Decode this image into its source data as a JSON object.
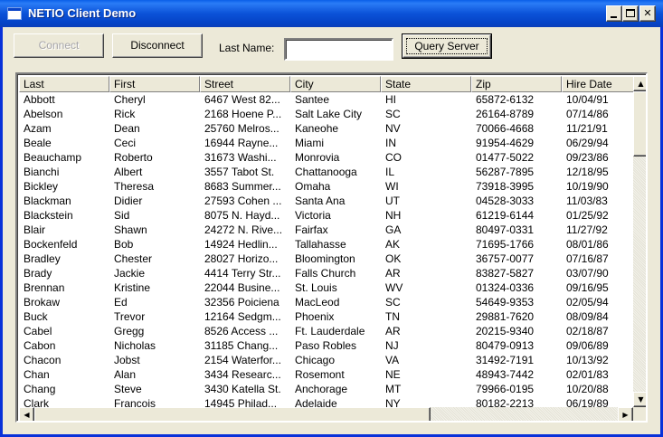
{
  "window": {
    "title": "NETIO Client Demo"
  },
  "icons": {
    "app": "window-icon",
    "minimize": "minimize-icon",
    "maximize": "maximize-icon",
    "close": "close-icon",
    "scroll_up": "up-arrow-icon",
    "scroll_down": "down-arrow-icon",
    "scroll_left": "left-arrow-icon",
    "scroll_right": "right-arrow-icon"
  },
  "toolbar": {
    "connect_label": "Connect",
    "disconnect_label": "Disconnect",
    "lastname_label": "Last Name:",
    "lastname_value": "",
    "query_label": "Query Server"
  },
  "table": {
    "columns": [
      "Last",
      "First",
      "Street",
      "City",
      "State",
      "Zip",
      "Hire Date"
    ],
    "rows": [
      [
        "Abbott",
        "Cheryl",
        "6467 West 82...",
        "Santee",
        "HI",
        "65872-6132",
        "10/04/91"
      ],
      [
        "Abelson",
        "Rick",
        "2168 Hoene P...",
        "Salt Lake City",
        "SC",
        "26164-8789",
        "07/14/86"
      ],
      [
        "Azam",
        "Dean",
        "25760 Melros...",
        "Kaneohe",
        "NV",
        "70066-4668",
        "11/21/91"
      ],
      [
        "Beale",
        "Ceci",
        "16944 Rayne...",
        "Miami",
        "IN",
        "91954-4629",
        "06/29/94"
      ],
      [
        "Beauchamp",
        "Roberto",
        "31673 Washi...",
        "Monrovia",
        "CO",
        "01477-5022",
        "09/23/86"
      ],
      [
        "Bianchi",
        "Albert",
        "3557 Tabot St.",
        "Chattanooga",
        "IL",
        "56287-7895",
        "12/18/95"
      ],
      [
        "Bickley",
        "Theresa",
        "8683 Summer...",
        "Omaha",
        "WI",
        "73918-3995",
        "10/19/90"
      ],
      [
        "Blackman",
        "Didier",
        "27593 Cohen ...",
        "Santa Ana",
        "UT",
        "04528-3033",
        "11/03/83"
      ],
      [
        "Blackstein",
        "Sid",
        "8075 N. Hayd...",
        "Victoria",
        "NH",
        "61219-6144",
        "01/25/92"
      ],
      [
        "Blair",
        "Shawn",
        "24272 N. Rive...",
        "Fairfax",
        "GA",
        "80497-0331",
        "11/27/92"
      ],
      [
        "Bockenfeld",
        "Bob",
        "14924 Hedlin...",
        "Tallahasse",
        "AK",
        "71695-1766",
        "08/01/86"
      ],
      [
        "Bradley",
        "Chester",
        "28027 Horizo...",
        "Bloomington",
        "OK",
        "36757-0077",
        "07/16/87"
      ],
      [
        "Brady",
        "Jackie",
        "4414 Terry Str...",
        "Falls Church",
        "AR",
        "83827-5827",
        "03/07/90"
      ],
      [
        "Brennan",
        "Kristine",
        "22044 Busine...",
        "St. Louis",
        "WV",
        "01324-0336",
        "09/16/95"
      ],
      [
        "Brokaw",
        "Ed",
        "32356 Poiciena",
        "MacLeod",
        "SC",
        "54649-9353",
        "02/05/94"
      ],
      [
        "Buck",
        "Trevor",
        "12164 Sedgm...",
        "Phoenix",
        "TN",
        "29881-7620",
        "08/09/84"
      ],
      [
        "Cabel",
        "Gregg",
        "8526 Access ...",
        "Ft. Lauderdale",
        "AR",
        "20215-9340",
        "02/18/87"
      ],
      [
        "Cabon",
        "Nicholas",
        "31185 Chang...",
        "Paso Robles",
        "NJ",
        "80479-0913",
        "09/06/89"
      ],
      [
        "Chacon",
        "Jobst",
        "2154 Waterfor...",
        "Chicago",
        "VA",
        "31492-7191",
        "10/13/92"
      ],
      [
        "Chan",
        "Alan",
        "3434 Researc...",
        "Rosemont",
        "NE",
        "48943-7442",
        "02/01/83"
      ],
      [
        "Chang",
        "Steve",
        "3430 Katella St.",
        "Anchorage",
        "MT",
        "79966-0195",
        "10/20/88"
      ],
      [
        "Clark",
        "Francois",
        "14945 Philad...",
        "Adelaide",
        "NY",
        "80182-2213",
        "06/19/89"
      ]
    ]
  },
  "colors": {
    "titlebar": "#0a52d8",
    "face": "#ece9d8",
    "disabled_text": "#a7a6aa"
  }
}
